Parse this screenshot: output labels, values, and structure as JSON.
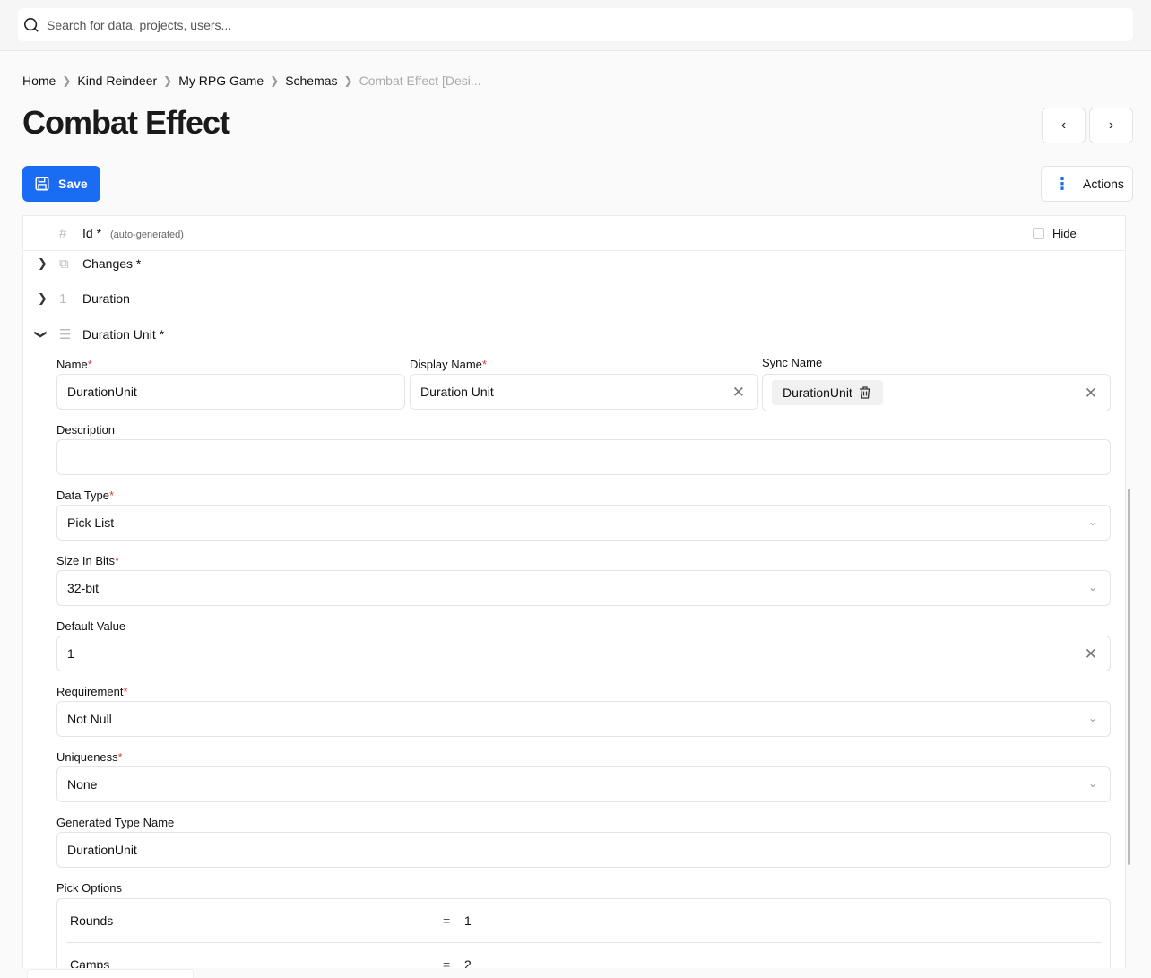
{
  "search": {
    "placeholder": "Search for data, projects, users..."
  },
  "breadcrumb": {
    "items": [
      "Home",
      "Kind Reindeer",
      "My RPG Game",
      "Schemas"
    ],
    "current": "Combat Effect [Desi..."
  },
  "page": {
    "title": "Combat Effect"
  },
  "toolbar": {
    "save_label": "Save",
    "actions_label": "Actions"
  },
  "properties": {
    "id": {
      "label": "Id *",
      "hint": "(auto-generated)",
      "hide_label": "Hide"
    },
    "changes": {
      "label": "Changes *"
    },
    "duration": {
      "label": "Duration"
    },
    "duration_unit": {
      "label": "Duration Unit *"
    }
  },
  "form": {
    "name": {
      "label": "Name",
      "value": "DurationUnit"
    },
    "display_name": {
      "label": "Display Name",
      "value": "Duration Unit"
    },
    "sync_name": {
      "label": "Sync Name",
      "value": "DurationUnit"
    },
    "description": {
      "label": "Description",
      "value": ""
    },
    "data_type": {
      "label": "Data Type",
      "value": "Pick List"
    },
    "size_in_bits": {
      "label": "Size In Bits",
      "value": "32-bit"
    },
    "default_value": {
      "label": "Default Value",
      "value": "1"
    },
    "requirement": {
      "label": "Requirement",
      "value": "Not Null"
    },
    "uniqueness": {
      "label": "Uniqueness",
      "value": "None"
    },
    "generated_type_name": {
      "label": "Generated Type Name",
      "value": "DurationUnit"
    },
    "pick_options": {
      "label": "Pick Options",
      "items": [
        {
          "name": "Rounds",
          "eq": "=",
          "value": "1"
        },
        {
          "name": "Camps",
          "eq": "=",
          "value": "2"
        }
      ]
    }
  },
  "required_marker": "*",
  "colors": {
    "accent": "#1a6cf5",
    "required": "#e23b3b"
  },
  "icons": [
    "search-icon",
    "save-icon",
    "more-vertical-icon",
    "chevron-left-icon",
    "chevron-right-icon",
    "hash-icon",
    "copy-icon",
    "number-icon",
    "list-icon",
    "trash-icon",
    "clear-icon",
    "chevron-down-icon"
  ]
}
